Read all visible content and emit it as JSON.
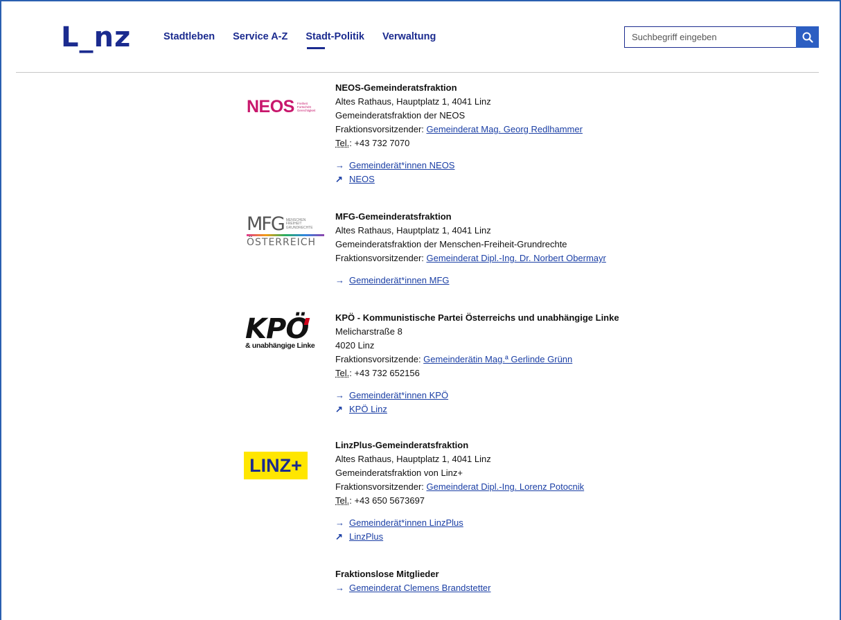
{
  "header": {
    "logo": "L_nz",
    "nav": [
      "Stadtleben",
      "Service A-Z",
      "Stadt-Politik",
      "Verwaltung"
    ],
    "active_nav": "Stadt-Politik",
    "search_placeholder": "Suchbegriff eingeben"
  },
  "logos": {
    "neos": {
      "name": "NEOS",
      "tagline": "Freiheit Fortschritt Gerechtigkeit"
    },
    "mfg": {
      "name": "MFG",
      "tagline": "MENSCHEN FREIHEIT GRUNDRECHTE",
      "country": "ÖSTERREICH"
    },
    "kpo": {
      "name": "KPÖ",
      "sub": "& unabhängige Linke"
    },
    "linz": {
      "name": "LINZ+"
    }
  },
  "entries": [
    {
      "title": "NEOS-Gemeinderatsfraktion",
      "address": "Altes Rathaus, Hauptplatz 1, 4041 Linz",
      "desc": "Gemeinderatsfraktion der NEOS",
      "chair_label": "Fraktionsvorsitzender: ",
      "chair_link": "Gemeinderat Mag. Georg Redlhammer",
      "tel_abbr": "Tel.",
      "tel": ": +43 732 7070",
      "link1": "Gemeinderät*innen NEOS",
      "link2": "NEOS"
    },
    {
      "title": "MFG-Gemeinderatsfraktion",
      "address": "Altes Rathaus, Hauptplatz 1, 4041 Linz",
      "desc": "Gemeinderatsfraktion der Menschen-Freiheit-Grundrechte",
      "chair_label": "Fraktionsvorsitzender: ",
      "chair_link": "Gemeinderat Dipl.-Ing. Dr. Norbert Obermayr",
      "link1": "Gemeinderät*innen MFG"
    },
    {
      "title": "KPÖ - Kommunistische Partei Österreichs und unabhängige Linke",
      "address1": "Melicharstraße 8",
      "address2": "4020 Linz",
      "chair_label": "Fraktionsvorsitzende: ",
      "chair_link": "Gemeinderätin Mag.ª Gerlinde Grünn",
      "tel_abbr": "Tel.",
      "tel": ": +43 732 652156",
      "link1": "Gemeinderät*innen KPÖ",
      "link2": "KPÖ Linz"
    },
    {
      "title": "LinzPlus-Gemeinderatsfraktion",
      "address": "Altes Rathaus, Hauptplatz 1, 4041 Linz",
      "desc": "Gemeinderatsfraktion von Linz+",
      "chair_label": "Fraktionsvorsitzender: ",
      "chair_link": "Gemeinderat Dipl.-Ing. Lorenz Potocnik",
      "tel_abbr": "Tel.",
      "tel": ": +43 650 5673697",
      "link1": "Gemeinderät*innen LinzPlus",
      "link2": "LinzPlus"
    },
    {
      "title": "Fraktionslose Mitglieder",
      "link1": "Gemeinderat Clemens Brandstetter"
    }
  ],
  "icons": {
    "internal": "arrow-right-icon",
    "external": "arrow-up-right-icon",
    "search": "search-icon"
  },
  "colors": {
    "brand": "#1b2b8f",
    "link": "#1b3fa5",
    "search_button": "#2c5ec2"
  }
}
